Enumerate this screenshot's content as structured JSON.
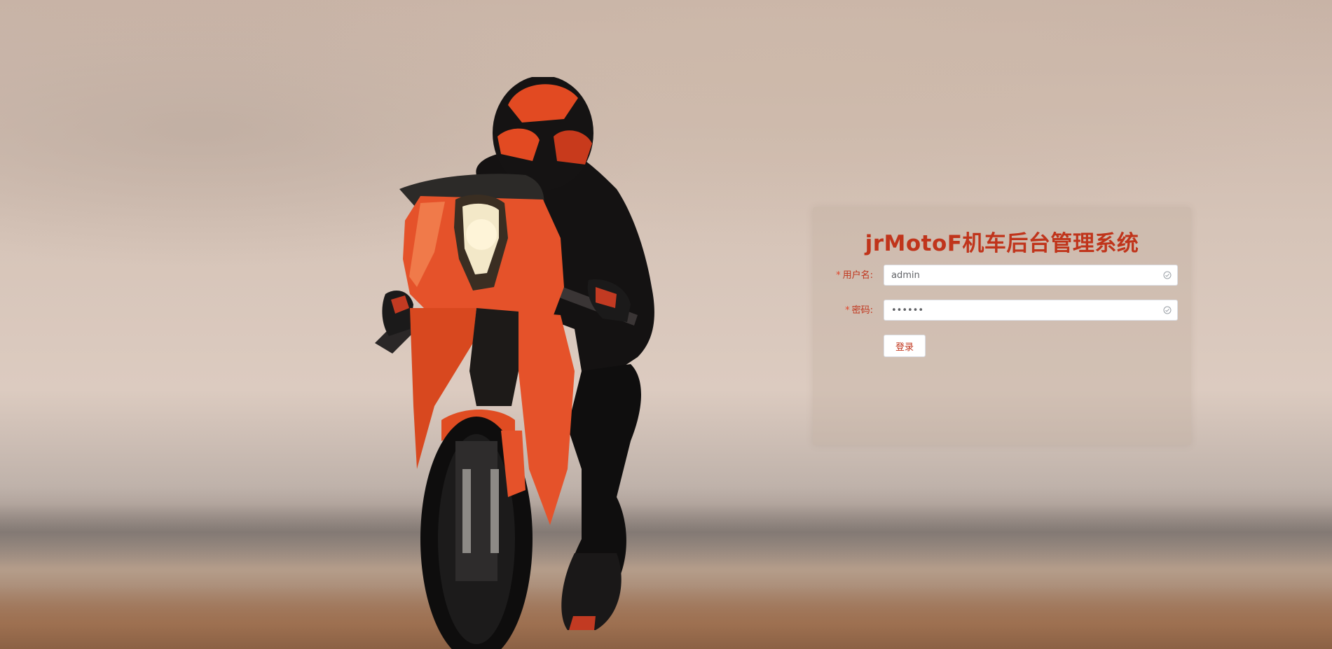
{
  "app": {
    "title": "jrMotoF机车后台管理系统"
  },
  "form": {
    "username": {
      "required_mark": "*",
      "label": "用户名:",
      "value": "admin",
      "status_icon": "check-circle-icon"
    },
    "password": {
      "required_mark": "*",
      "label": "密码:",
      "value": "••••••",
      "status_icon": "check-circle-icon"
    },
    "submit_label": "登录"
  },
  "colors": {
    "accent": "#c0341b",
    "panel_bg": "rgba(190,170,155,0.32)",
    "input_bg": "#ffffff"
  }
}
